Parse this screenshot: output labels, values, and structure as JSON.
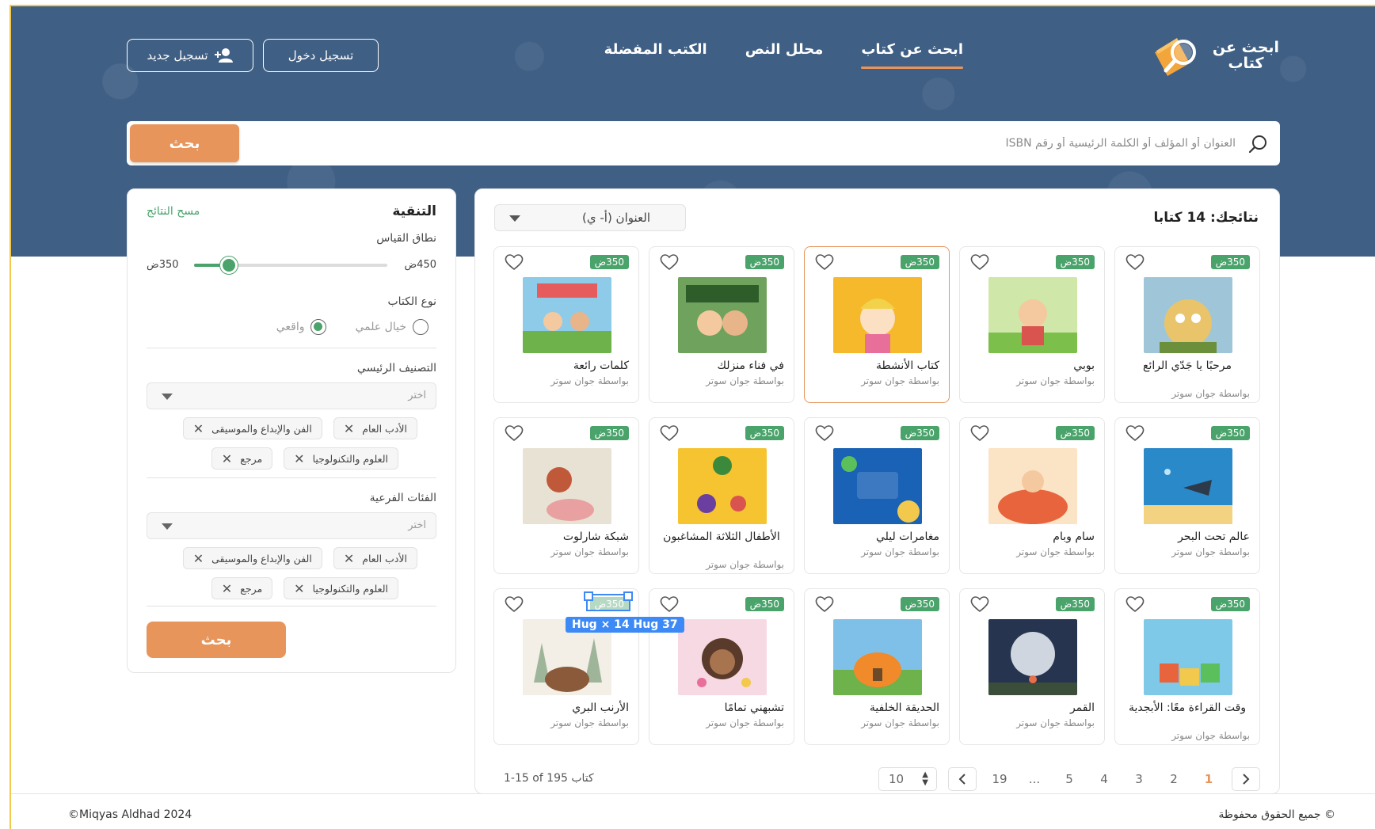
{
  "app": {
    "logo_text": "ابحث عن كتاب",
    "accent_color": "#e8955b",
    "green_color": "#4aa36b",
    "header_bg": "#3f5f84"
  },
  "nav": {
    "items": [
      {
        "label": "ابحث عن كتاب",
        "active": true
      },
      {
        "label": "محلل النص",
        "active": false
      },
      {
        "label": "الكتب المفضلة",
        "active": false
      }
    ]
  },
  "auth": {
    "login_label": "تسجيل دخول",
    "register_label": "تسجيل جديد",
    "register_icon": "user-plus-icon"
  },
  "search": {
    "placeholder": "العنوان أو المؤلف أو الكلمة الرئيسية أو رقم ISBN",
    "button_label": "بحث"
  },
  "results": {
    "title": "نتائجك: 14 كتابا",
    "sort_value": "العنوان (أ- ي)",
    "books": [
      {
        "title": "مرحبًا يا جَدّي الرائع",
        "author": "بواسطة جوان سوتر",
        "badge": "350ض",
        "cover": "hey-grandude"
      },
      {
        "title": "بوبي",
        "author": "بواسطة جوان سوتر",
        "badge": "350ض",
        "cover": "poppy"
      },
      {
        "title": "كتاب الأنشطة",
        "author": "بواسطة جوان سوتر",
        "badge": "350ض",
        "cover": "activity",
        "selected": true
      },
      {
        "title": "في فناء منزلك",
        "author": "بواسطة جوان سوتر",
        "badge": "350ض",
        "cover": "backyard-own"
      },
      {
        "title": "كلمات رائعة",
        "author": "بواسطة جوان سوتر",
        "badge": "350ض",
        "cover": "awesome-words"
      },
      {
        "title": "عالم تحت البحر",
        "author": "بواسطة جوان سوتر",
        "badge": "350ض",
        "cover": "undersea"
      },
      {
        "title": "سام وبام",
        "author": "بواسطة جوان سوتر",
        "badge": "350ض",
        "cover": "sam-pam"
      },
      {
        "title": "مغامرات ليلي",
        "author": "بواسطة جوان سوتر",
        "badge": "350ض",
        "cover": "lily"
      },
      {
        "title": "الأطفال الثلاثة المشاغبون",
        "author": "بواسطة جوان سوتر",
        "badge": "350ض",
        "cover": "three-kids"
      },
      {
        "title": "شبكة شارلوت",
        "author": "بواسطة جوان سوتر",
        "badge": "350ض",
        "cover": "charlotte"
      },
      {
        "title": "وقت القراءة معًا: الأبجدية",
        "author": "بواسطة جوان سوتر",
        "badge": "350ض",
        "cover": "read-together"
      },
      {
        "title": "القمر",
        "author": "بواسطة جوان سوتر",
        "badge": "350ض",
        "cover": "moon"
      },
      {
        "title": "الحديقة الخلفية",
        "author": "بواسطة جوان سوتر",
        "badge": "350ض",
        "cover": "backyard"
      },
      {
        "title": "تشبهني تمامًا",
        "author": "بواسطة جوان سوتر",
        "badge": "350ض",
        "cover": "just-like-me"
      },
      {
        "title": "الأرنب البري",
        "author": "بواسطة جوان سوتر",
        "badge": "350ض",
        "cover": "hare"
      }
    ],
    "measure_overlay": "37 Hug × 14 Hug"
  },
  "pagination": {
    "range_label": "1-15 of 195 كتاب",
    "pages": [
      "1",
      "2",
      "3",
      "4",
      "5",
      "...",
      "19"
    ],
    "active_page": "1",
    "per_page": "10"
  },
  "filters": {
    "title": "التنقية",
    "clear_label": "مسح النتائج",
    "range_label": "نطاق القياس",
    "range_min": "350ض",
    "range_max": "450ض",
    "range_fraction": 0.18,
    "type_label": "نوع الكتاب",
    "type_options": [
      {
        "label": "خيال علمي",
        "checked": false
      },
      {
        "label": "واقعي",
        "checked": true
      }
    ],
    "main_category_label": "التصنيف الرئيسي",
    "main_category_placeholder": "اختر",
    "main_chips": [
      "الأدب العام",
      "الفن والإبداع والموسيقى",
      "العلوم والتكنولوجيا",
      "مرجع"
    ],
    "sub_category_label": "الفئات الفرعية",
    "sub_category_placeholder": "اختر",
    "sub_chips": [
      "الأدب العام",
      "الفن والإبداع والموسيقى",
      "العلوم والتكنولوجيا",
      "مرجع"
    ],
    "search_label": "بحث"
  },
  "footer": {
    "copyright_left": "©Miqyas Aldhad 2024",
    "copyright_right": "© جميع الحقوق محفوظة"
  }
}
